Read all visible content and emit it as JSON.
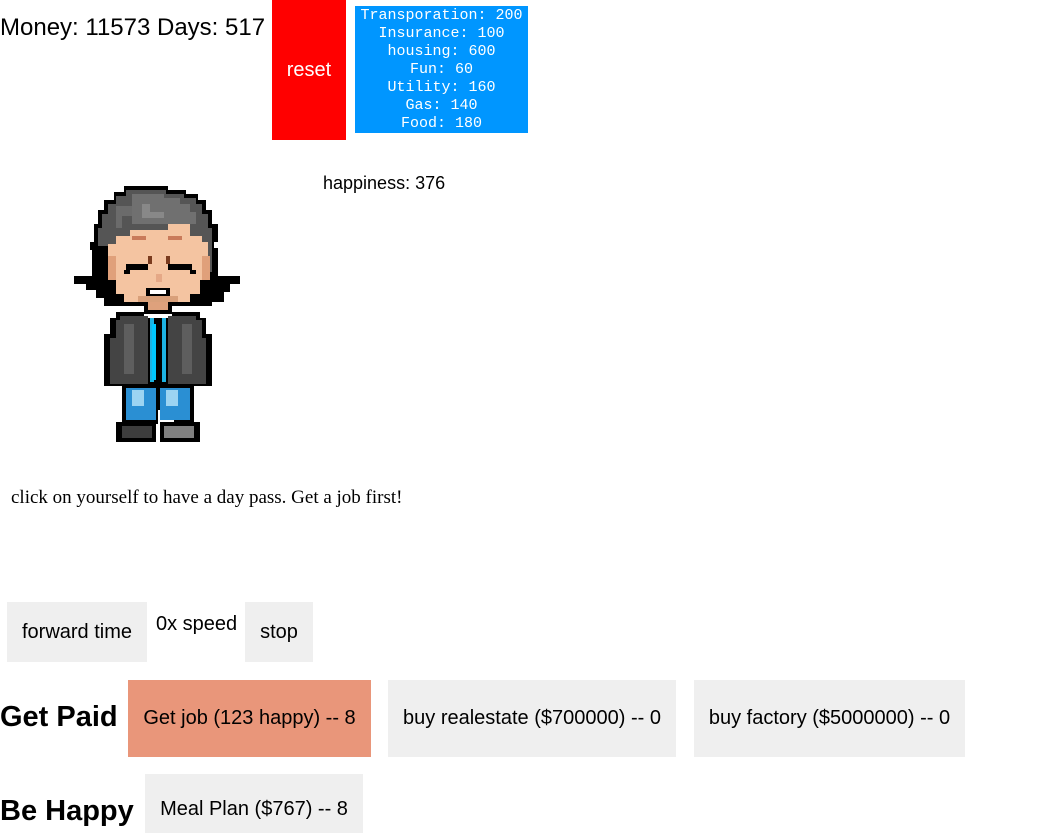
{
  "stats": {
    "text": "Money: 11573 Days: 517"
  },
  "reset_label": "reset",
  "expenses": [
    "Transporation: 200",
    "Insurance: 100",
    "housing: 600",
    "Fun: 60",
    "Utility: 160",
    "Gas: 140",
    "Food: 180"
  ],
  "happiness_text": "happiness: 376",
  "hint_text": "click on yourself to have a day pass. Get a job first!",
  "time_controls": {
    "forward_label": "forward time",
    "speed_label": "0x speed",
    "stop_label": "stop"
  },
  "get_paid": {
    "title": "Get Paid",
    "job_label": "Get job (123 happy) -- 8",
    "realestate_label": "buy realestate ($700000) -- 0",
    "factory_label": "buy factory ($5000000) -- 0"
  },
  "be_happy": {
    "title": "Be Happy",
    "meal_label": "Meal Plan ($767) -- 8"
  },
  "colors": {
    "reset": "#ff0000",
    "expenses_bg": "#0096ff",
    "job_button": "#e9967a",
    "button_gray": "#efefef"
  },
  "icons": {
    "avatar": "pixel-character-icon"
  }
}
